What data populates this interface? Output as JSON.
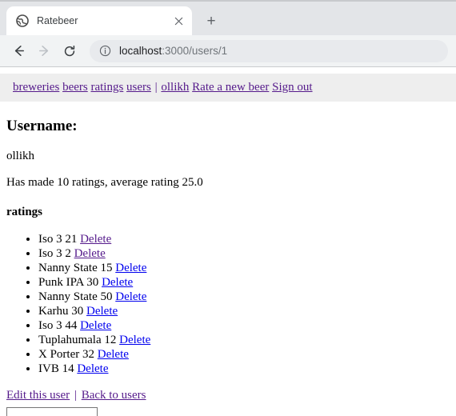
{
  "browser": {
    "tab": {
      "title": "Ratebeer",
      "favicon_icon": "globe-icon",
      "close_icon": "close-icon"
    },
    "new_tab_label": "+",
    "toolbar": {
      "back_icon": "arrow-left-icon",
      "forward_icon": "arrow-right-icon",
      "reload_icon": "reload-icon",
      "security_icon": "info-circle-icon",
      "url_host": "localhost",
      "url_path": ":3000/users/1"
    }
  },
  "site_nav": {
    "links": [
      {
        "label": "breweries"
      },
      {
        "label": "beers"
      },
      {
        "label": "ratings"
      },
      {
        "label": "users"
      }
    ],
    "separator": "|",
    "user_links": [
      {
        "label": "ollikh"
      },
      {
        "label": "Rate a new beer"
      },
      {
        "label": "Sign out"
      }
    ]
  },
  "main": {
    "page_title": "Username:",
    "username": "ollikh",
    "summary": "Has made 10 ratings, average rating 25.0",
    "section_title": "ratings",
    "ratings": [
      {
        "text": "Iso 3 21",
        "delete_label": "Delete",
        "visited": true
      },
      {
        "text": "Iso 3 2",
        "delete_label": "Delete",
        "visited": true
      },
      {
        "text": "Nanny State 15",
        "delete_label": "Delete",
        "visited": false
      },
      {
        "text": "Punk IPA 30",
        "delete_label": "Delete",
        "visited": false
      },
      {
        "text": "Nanny State 50",
        "delete_label": "Delete",
        "visited": false
      },
      {
        "text": "Karhu 30",
        "delete_label": "Delete",
        "visited": false
      },
      {
        "text": "Iso 3 44",
        "delete_label": "Delete",
        "visited": false
      },
      {
        "text": "Tuplahumala 12",
        "delete_label": "Delete",
        "visited": false
      },
      {
        "text": "X Porter 32",
        "delete_label": "Delete",
        "visited": false
      },
      {
        "text": "IVB 14",
        "delete_label": "Delete",
        "visited": false
      }
    ],
    "footer": {
      "edit_label": "Edit this user",
      "separator": "|",
      "back_label": "Back to users"
    },
    "bottom_input_value": ""
  },
  "colors": {
    "link_unvisited": "#0000ee",
    "link_visited": "#551a8b",
    "nav_background": "#eeeeee",
    "tabstrip": "#e3e5e8",
    "toolbar": "#f1f3f4",
    "omnibox": "#e8eaed"
  }
}
